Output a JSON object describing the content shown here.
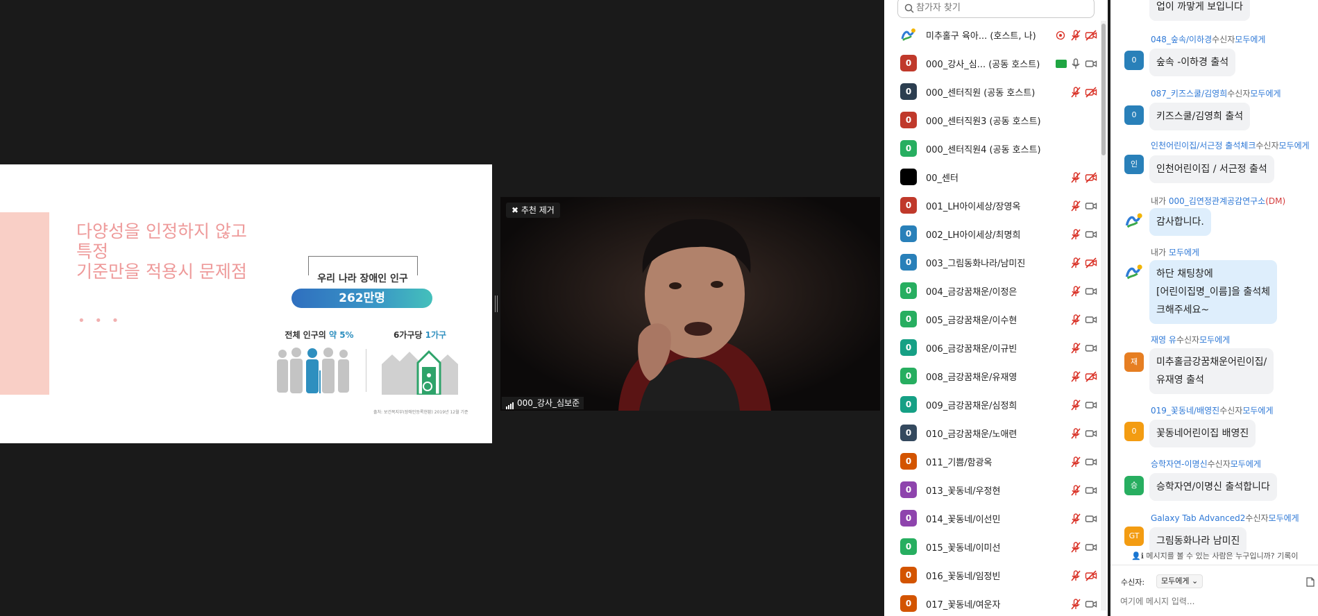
{
  "slide": {
    "title": "다양성을 인정하지 않고\n특정\n기준만을 적용시 문제점",
    "dots": "• • •",
    "subtitle": "우리 나라 장애인 인구",
    "pill": "262만명",
    "stat1_prefix": "전체 인구의 ",
    "stat1_highlight": "약 5%",
    "stat2_prefix": "6가구당 ",
    "stat2_highlight": "1가구",
    "source": "출처: 보건복지부(장애인등록현황) 2019년 12월 기준"
  },
  "speaker": {
    "pin_label": "추천 제거",
    "name": "000_강사_심보준"
  },
  "participants": {
    "search_placeholder": "참가자 찾기",
    "rows": [
      {
        "avatar": "",
        "color": "#ffffff",
        "name": "미추홀구 육아...  (호스트, 나)",
        "mic": "muted",
        "video": "off",
        "rec": true
      },
      {
        "avatar": "0",
        "color": "#c0392b",
        "name": "000_강사_심...  (공동 호스트)",
        "mic": "on",
        "video": "on",
        "share": true
      },
      {
        "avatar": "0",
        "color": "#2c3e50",
        "name": "000_센터직원 (공동 호스트)",
        "mic": "muted",
        "video": "off"
      },
      {
        "avatar": "0",
        "color": "#c0392b",
        "name": "000_센터직원3 (공동 호스트)",
        "mic": "",
        "video": ""
      },
      {
        "avatar": "0",
        "color": "#27ae60",
        "name": "000_센터직원4 (공동 호스트)",
        "mic": "",
        "video": ""
      },
      {
        "avatar": "",
        "color": "#000000",
        "name": "00_센터",
        "mic": "muted",
        "video": "off"
      },
      {
        "avatar": "0",
        "color": "#c0392b",
        "name": "001_LH아이세상/장영옥",
        "mic": "muted",
        "video": "on"
      },
      {
        "avatar": "0",
        "color": "#2980b9",
        "name": "002_LH아이세상/최명희",
        "mic": "muted",
        "video": "on"
      },
      {
        "avatar": "0",
        "color": "#2980b9",
        "name": "003_그림동화나라/남미진",
        "mic": "muted",
        "video": "off"
      },
      {
        "avatar": "0",
        "color": "#27ae60",
        "name": "004_금강꿈채운/이정은",
        "mic": "muted",
        "video": "on"
      },
      {
        "avatar": "0",
        "color": "#27ae60",
        "name": "005_금강꿈채운/이수현",
        "mic": "muted",
        "video": "on"
      },
      {
        "avatar": "0",
        "color": "#16a085",
        "name": "006_금강꿈채운/이규빈",
        "mic": "muted",
        "video": "on"
      },
      {
        "avatar": "0",
        "color": "#27ae60",
        "name": "008_금강꿈채운/유재영",
        "mic": "muted",
        "video": "off"
      },
      {
        "avatar": "0",
        "color": "#16a085",
        "name": "009_금강꿈채운/심정희",
        "mic": "muted",
        "video": "on"
      },
      {
        "avatar": "0",
        "color": "#34495e",
        "name": "010_금강꿈채운/노애련",
        "mic": "muted",
        "video": "on"
      },
      {
        "avatar": "0",
        "color": "#d35400",
        "name": "011_기쁨/함광옥",
        "mic": "muted",
        "video": "on"
      },
      {
        "avatar": "0",
        "color": "#8e44ad",
        "name": "013_꽃동네/우정현",
        "mic": "muted",
        "video": "on"
      },
      {
        "avatar": "0",
        "color": "#8e44ad",
        "name": "014_꽃동네/이선민",
        "mic": "muted",
        "video": "on"
      },
      {
        "avatar": "0",
        "color": "#27ae60",
        "name": "015_꽃동네/이미선",
        "mic": "muted",
        "video": "on"
      },
      {
        "avatar": "0",
        "color": "#d35400",
        "name": "016_꽃동네/임정빈",
        "mic": "muted",
        "video": "off"
      },
      {
        "avatar": "0",
        "color": "#d35400",
        "name": "017_꽃동네/여운자",
        "mic": "muted",
        "video": "on"
      }
    ]
  },
  "chat": {
    "messages": [
      {
        "sender": "",
        "to_text": "",
        "recipient": "",
        "dm": "",
        "avatar": "",
        "avatar_color": "",
        "text": "업이 까맣게 보입니다",
        "me": false
      },
      {
        "sender": "048_숲속/이하경",
        "to_text": "수신자",
        "recipient": "모두에게",
        "dm": "",
        "avatar": "0",
        "avatar_color": "#2980b9",
        "text": "숲속 -이하경 출석",
        "me": false
      },
      {
        "sender": "087_키즈스쿨/김영희",
        "to_text": "수신자",
        "recipient": "모두에게",
        "dm": "",
        "avatar": "0",
        "avatar_color": "#2980b9",
        "text": "키즈스쿨/김영희 출석",
        "me": false
      },
      {
        "sender": "인천어린이집/서근정 출석체크",
        "to_text": "수신자",
        "recipient": "모두에게",
        "dm": "",
        "avatar": "인",
        "avatar_color": "#2980b9",
        "text": "인천어린이집 / 서근정 출석",
        "me": false
      },
      {
        "sender": "내가 ",
        "to_text": "",
        "recipient": "000_김연정관계공감연구소",
        "dm": "(DM)",
        "avatar": "",
        "avatar_color": "",
        "text": "감사합니다.",
        "me": true
      },
      {
        "sender": "내가 ",
        "to_text": "",
        "recipient": "모두에게",
        "dm": "",
        "avatar": "",
        "avatar_color": "",
        "text": "하단 채팅창에\n[어린이집명_이름]을 출석체\n크해주세요~",
        "me": true
      },
      {
        "sender": "재영 유",
        "to_text": "수신자",
        "recipient": "모두에게",
        "dm": "",
        "avatar": "재",
        "avatar_color": "#e67e22",
        "text": "미추홀금강꿈채운어린이집/\n유재영 출석",
        "me": false
      },
      {
        "sender": "019_꽃동네/배영진",
        "to_text": "수신자",
        "recipient": "모두에게",
        "dm": "",
        "avatar": "0",
        "avatar_color": "#f39c12",
        "text": "꽃동네어린이집 배영진",
        "me": false
      },
      {
        "sender": "승학자연-이명신",
        "to_text": "수신자",
        "recipient": "모두에게",
        "dm": "",
        "avatar": "승",
        "avatar_color": "#27ae60",
        "text": "승학자연/이명신 출석합니다",
        "me": false
      },
      {
        "sender": "Galaxy Tab Advanced2",
        "to_text": "수신자",
        "recipient": "모두에게",
        "dm": "",
        "avatar": "GT",
        "avatar_color": "#f39c12",
        "text": "그림동화나라  남미진",
        "me": false
      }
    ],
    "visibility_notice": "메시지를 볼 수 있는 사람은 누구입니까? 기록이",
    "to_label": "수신자:",
    "to_value": "모두에게",
    "input_placeholder": "여기에 메시지 입력..."
  }
}
